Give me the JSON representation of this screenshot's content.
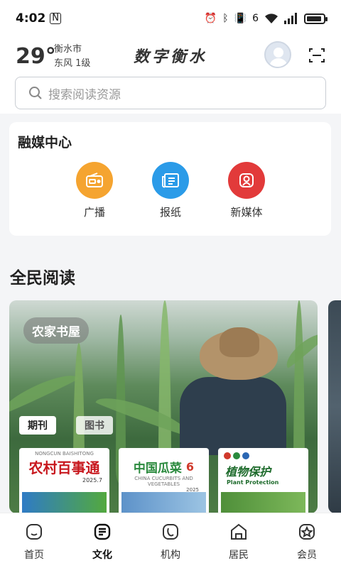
{
  "status_bar": {
    "time": "4:02",
    "nfc": "N",
    "network": "6"
  },
  "header": {
    "temperature": "29°",
    "city": "衡水市",
    "wind": "东风  1级",
    "brand": "数字衡水"
  },
  "search": {
    "placeholder": "搜索阅读资源"
  },
  "media_center": {
    "title": "融媒中心",
    "items": [
      {
        "label": "广播",
        "icon": "radio-icon",
        "color": "#f5a430"
      },
      {
        "label": "报纸",
        "icon": "newspaper-icon",
        "color": "#2b9be8"
      },
      {
        "label": "新媒体",
        "icon": "new-media-icon",
        "color": "#e23a3a"
      }
    ]
  },
  "reading": {
    "title": "全民阅读",
    "banner_tag": "农家书屋",
    "tabs": [
      {
        "label": "期刊"
      },
      {
        "label": "图书"
      }
    ],
    "magazines": [
      {
        "title": "农村百事通",
        "subtitle": "NONGCUN BAISHITONG",
        "issue": "2025.7"
      },
      {
        "title": "中国瓜菜",
        "subtitle": "CHINA CUCURBITS AND VEGETABLES",
        "issue": "6",
        "year": "2025"
      },
      {
        "title": "植物保护",
        "subtitle": "Plant Protection"
      }
    ]
  },
  "tabbar": {
    "items": [
      {
        "label": "首页",
        "icon": "home-icon"
      },
      {
        "label": "文化",
        "icon": "culture-icon",
        "active": true
      },
      {
        "label": "机构",
        "icon": "institution-icon"
      },
      {
        "label": "居民",
        "icon": "resident-icon"
      },
      {
        "label": "会员",
        "icon": "member-icon"
      }
    ]
  },
  "colors": {
    "accent": "#2b9be8",
    "brand_dark": "#222222",
    "background": "#f4f5f7"
  }
}
